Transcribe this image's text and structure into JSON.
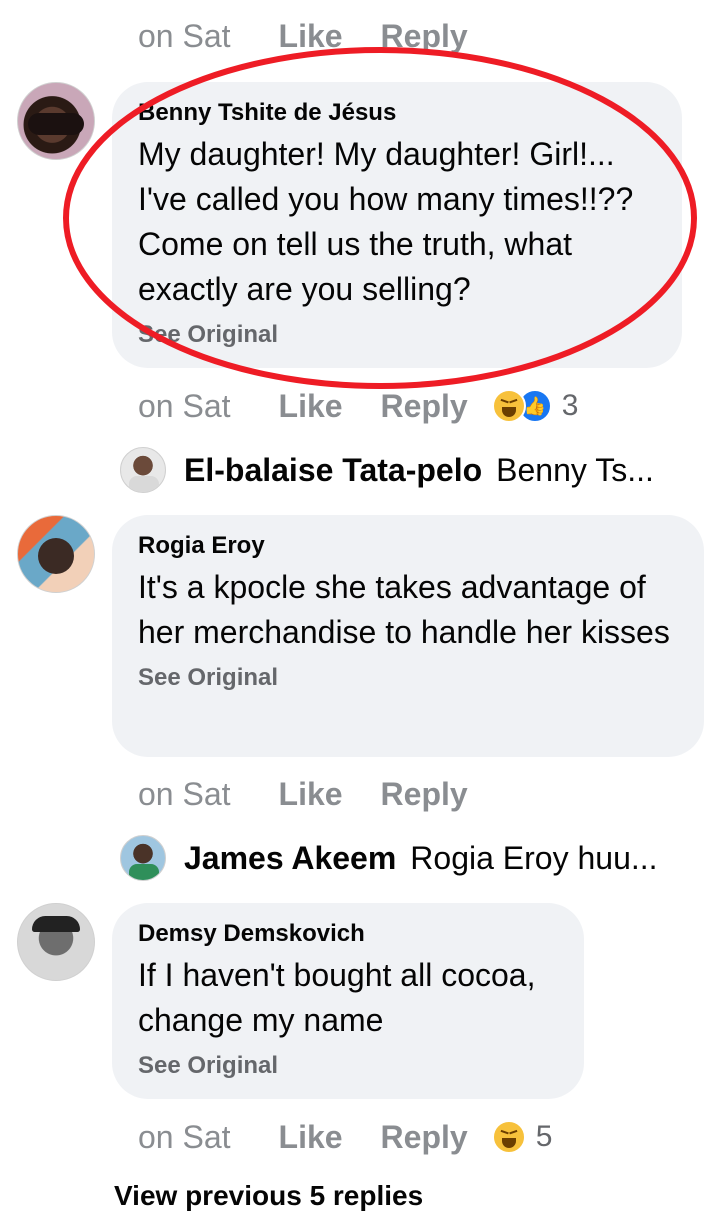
{
  "top_actions": {
    "time": "on Sat",
    "like": "Like",
    "reply": "Reply"
  },
  "comments": [
    {
      "author": "Benny Tshite de Jésus",
      "text": "My daughter! My daughter! Girl!... I've called you how many times!!?? Come on tell us the truth, what exactly are you selling?",
      "see_original": "See Original",
      "time": "on Sat",
      "like": "Like",
      "reply": "Reply",
      "reaction_count": "3",
      "reply_preview": {
        "name": "El-balaise Tata-pelo",
        "text": "Benny Ts..."
      }
    },
    {
      "author": "Rogia Eroy",
      "text": "It's a kpocle she takes advantage of her merchandise to handle her kisses",
      "see_original": "See Original",
      "time": "on Sat",
      "like": "Like",
      "reply": "Reply",
      "reply_preview": {
        "name": "James Akeem",
        "text": "Rogia Eroy huu..."
      }
    },
    {
      "author": "Demsy Demskovich",
      "text": "If I haven't bought all cocoa, change my name",
      "see_original": "See Original",
      "time": "on Sat",
      "like": "Like",
      "reply": "Reply",
      "reaction_count": "5"
    }
  ],
  "view_previous": "View previous 5 replies",
  "colors": {
    "bubble": "#f0f2f5",
    "muted": "#8a8d91",
    "highlight_ring": "#ee1c25",
    "like_blue": "#1877f2",
    "haha_yellow": "#f7c13b"
  }
}
